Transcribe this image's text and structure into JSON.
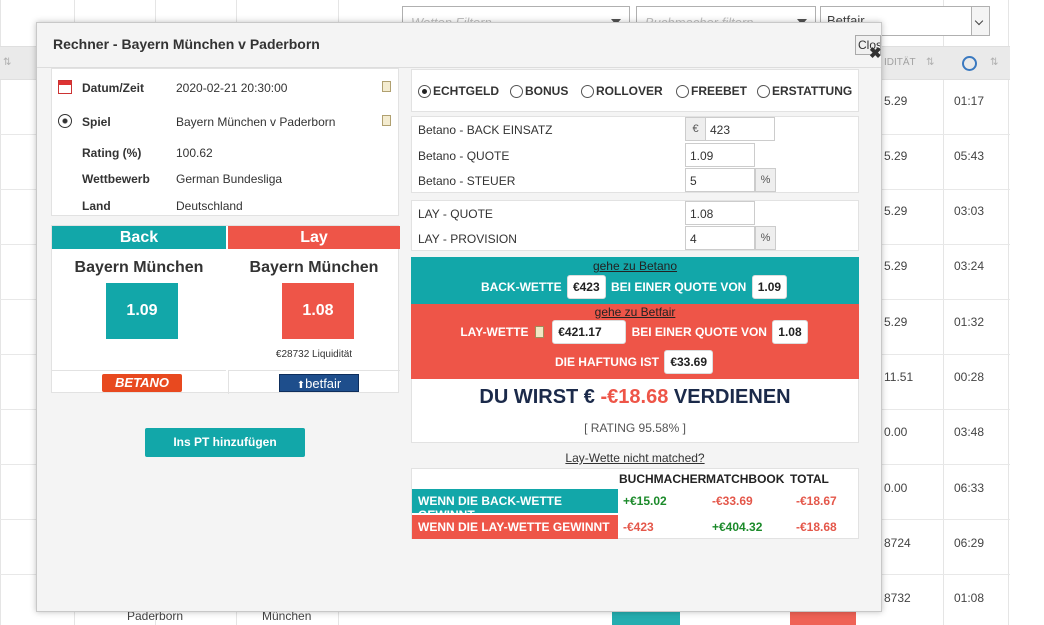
{
  "background": {
    "filters": {
      "bet_filter_placeholder": "Wetten Filtern",
      "bookmaker_filter_placeholder": "Buchmacher filtern",
      "exchange_select": "Betfair"
    },
    "columns": {
      "liquidity_header": "IDITÄT"
    },
    "rows": [
      {
        "liquidity": "5.29",
        "time": "01:17"
      },
      {
        "liquidity": "5.29",
        "time": "05:43"
      },
      {
        "liquidity": "5.29",
        "time": "03:03"
      },
      {
        "liquidity": "5.29",
        "time": "03:24"
      },
      {
        "liquidity": "5.29",
        "time": "01:32"
      },
      {
        "liquidity": "11.51",
        "time": "00:28"
      },
      {
        "liquidity": "0.00",
        "time": "03:48"
      },
      {
        "liquidity": "0.00",
        "time": "06:33"
      },
      {
        "liquidity": "8724",
        "time": "06:29"
      },
      {
        "liquidity": "8732",
        "time": "01:08"
      }
    ],
    "partial_team_a": "Paderborn",
    "partial_team_b": "München"
  },
  "modal": {
    "title": "Rechner - Bayern München v Paderborn",
    "close_label": "Close",
    "info": {
      "datetime_label": "Datum/Zeit",
      "datetime_value": "2020-02-21 20:30:00",
      "match_label": "Spiel",
      "match_value": "Bayern München v Paderborn",
      "rating_label": "Rating (%)",
      "rating_value": "100.62",
      "competition_label": "Wettbewerb",
      "competition_value": "German Bundesliga",
      "country_label": "Land",
      "country_value": "Deutschland"
    },
    "back": {
      "header": "Back",
      "team": "Bayern München",
      "odds": "1.09",
      "bookmaker": "BETANO",
      "color": "#12a7a9"
    },
    "lay": {
      "header": "Lay",
      "team": "Bayern München",
      "odds": "1.08",
      "liquidity": "€28732 Liquidität",
      "exchange": "betfair",
      "color": "#ee5548"
    },
    "add_pt_button": "Ins PT hinzufügen",
    "bet_types": [
      "ECHTGELD",
      "BONUS",
      "ROLLOVER",
      "FREEBET",
      "ERSTATTUNG"
    ],
    "selected_bet_type": "ECHTGELD",
    "back_fields": {
      "stake_label": "Betano - BACK EINSATZ",
      "stake_currency": "€",
      "stake_value": "423",
      "odds_label": "Betano - QUOTE",
      "odds_value": "1.09",
      "tax_label": "Betano - STEUER",
      "tax_value": "5",
      "tax_unit": "%"
    },
    "lay_fields": {
      "odds_label": "LAY - QUOTE",
      "odds_value": "1.08",
      "commission_label": "LAY - PROVISION",
      "commission_value": "4",
      "commission_unit": "%"
    },
    "back_instruction": {
      "link": "gehe zu Betano",
      "prefix": "BACK-WETTE",
      "stake": "€423",
      "middle": "BEI EINER QUOTE VON",
      "odds": "1.09"
    },
    "lay_instruction": {
      "link": "gehe zu Betfair",
      "prefix": "LAY-WETTE",
      "stake": "€421.17",
      "middle": "BEI EINER QUOTE VON",
      "odds": "1.08",
      "liability_prefix": "DIE HAFTUNG IST",
      "liability": "€33.69"
    },
    "result": {
      "prefix": "DU WIRST €",
      "amount": "-€18.68",
      "suffix": "VERDIENEN",
      "rating": "[ RATING 95.58% ]"
    },
    "not_matched_link": "Lay-Wette nicht matched?",
    "outcomes": {
      "headers": [
        "BUCHMACHER",
        "MATCHBOOK",
        "TOTAL"
      ],
      "rows": [
        {
          "label": "WENN DIE BACK-WETTE GEWINNT",
          "bookmaker": "+€15.02",
          "matchbook": "-€33.69",
          "total": "-€18.67"
        },
        {
          "label": "WENN DIE LAY-WETTE GEWINNT",
          "bookmaker": "-€423",
          "matchbook": "+€404.32",
          "total": "-€18.68"
        }
      ]
    }
  }
}
